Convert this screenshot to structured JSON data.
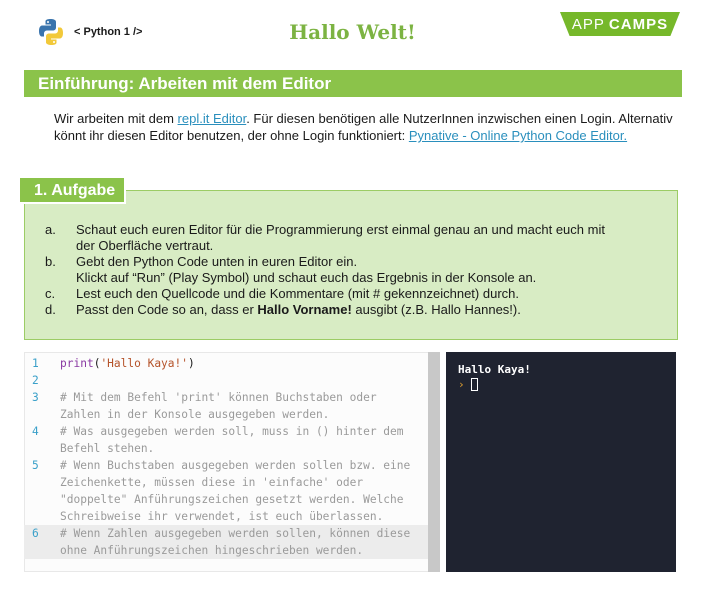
{
  "header": {
    "course_tag": "< Python 1 />",
    "title": "Hallo Welt!",
    "brand_light": "APP",
    "brand_bold": "CAMPS",
    "brand_color": "#76b82a",
    "title_color": "#7cb342"
  },
  "intro": {
    "title": "Einführung: Arbeiten mit dem Editor",
    "text_before": "Wir arbeiten mit dem ",
    "link1": "repl.it Editor",
    "text_middle": ". Für diesen benötigen alle NutzerInnen inzwischen einen Login. Alternativ könnt ihr diesen Editor benutzen, der ohne Login funktioniert: ",
    "link2": "Pynative - Online Python Code Editor."
  },
  "task": {
    "label": "1. Aufgabe",
    "items": [
      {
        "letter": "a.",
        "lines": [
          "Schaut euch euren Editor für die Programmierung erst einmal genau an und macht euch mit",
          "der Oberfläche vertraut."
        ]
      },
      {
        "letter": "b.",
        "lines": [
          "Gebt den Python Code unten in euren Editor ein.",
          "Klickt auf “Run” (Play Symbol) und schaut euch das Ergebnis in der Konsole an."
        ]
      },
      {
        "letter": "c.",
        "lines": [
          "Lest euch den Quellcode und die Kommentare (mit # gekennzeichnet) durch."
        ]
      },
      {
        "letter": "d.",
        "before": "Passt den Code so an, dass er ",
        "bold": "Hallo Vorname!",
        "after": " ausgibt (z.B. Hallo Hannes!)."
      }
    ]
  },
  "editor": {
    "lines": [
      {
        "num": "1",
        "kind": "code",
        "fn": "print",
        "arg": "'Hallo Kaya!'"
      },
      {
        "num": "2",
        "kind": "blank",
        "text": ""
      },
      {
        "num": "3",
        "kind": "comment",
        "text": "# Mit dem Befehl 'print' können Buchstaben oder"
      },
      {
        "num": "",
        "kind": "comment",
        "text": "Zahlen in der Konsole ausgegeben werden."
      },
      {
        "num": "4",
        "kind": "comment",
        "text": "# Was ausgegeben werden soll, muss in () hinter dem"
      },
      {
        "num": "",
        "kind": "comment",
        "text": "Befehl stehen."
      },
      {
        "num": "5",
        "kind": "comment",
        "text": "# Wenn Buchstaben ausgegeben werden sollen bzw. eine"
      },
      {
        "num": "",
        "kind": "comment",
        "text": "Zeichenkette, müssen diese in 'einfache' oder"
      },
      {
        "num": "",
        "kind": "comment",
        "text": "\"doppelte\" Anführungszeichen gesetzt werden. Welche"
      },
      {
        "num": "",
        "kind": "comment",
        "text": "Schreibweise ihr verwendet, ist euch überlassen."
      },
      {
        "num": "6",
        "kind": "comment",
        "text": "# Wenn Zahlen ausgegeben werden sollen, können diese",
        "active": true
      },
      {
        "num": "",
        "kind": "comment",
        "text": "ohne Anführungszeichen hingeschrieben werden.",
        "active": true
      }
    ]
  },
  "console": {
    "output": "Hallo Kaya!",
    "prompt": "›"
  }
}
